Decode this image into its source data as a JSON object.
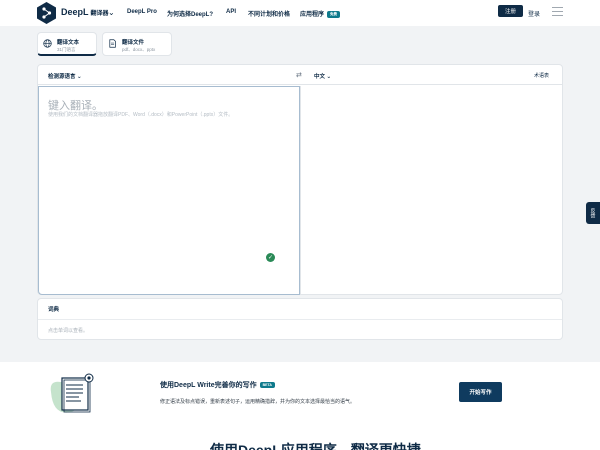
{
  "nav": {
    "brand": "DeepL",
    "brand_sub": "翻译器",
    "links": [
      "DeepL Pro",
      "为何选择DeepL?",
      "API",
      "不同计划和价格",
      "应用程序"
    ],
    "apps_badge": "免费",
    "signup": "注册",
    "login": "登录"
  },
  "tabs": {
    "text_title": "翻译文本",
    "text_sub": "31门语言",
    "file_title": "翻译文件",
    "file_sub": "pdf、docx、pptx"
  },
  "translator": {
    "source_lang": "检测源语言",
    "target_lang": "中文",
    "glossary": "术语表",
    "placeholder": "键入翻译。",
    "hint": "使用我们的文档翻译器拖放翻译PDF、Word（.docx）和PowerPoint（.pptx）文件。"
  },
  "dictionary": {
    "title": "词典",
    "hint": "点击单词以查看。"
  },
  "feedback": "反馈",
  "promo": {
    "title": "使用DeepL Write完善你的写作",
    "badge": "BETA",
    "desc": "修正语法及标点错误，重新表述句子，运用精确措辞，并为你的文本选择最恰当的语气。",
    "button": "开始写作"
  },
  "bottom_title": "使用DeepL应用程序，翻译更快捷",
  "colors": {
    "brand": "#0f2b46",
    "accent": "#0f7a8c",
    "grammar": "#2a8a57"
  }
}
